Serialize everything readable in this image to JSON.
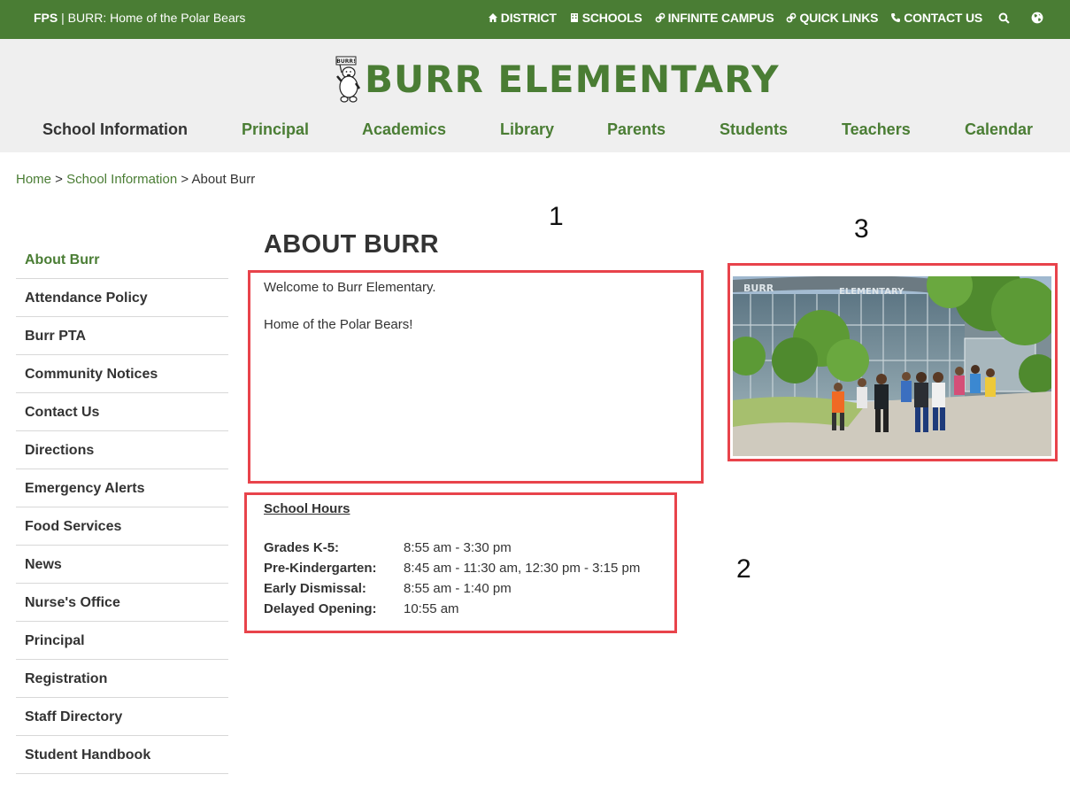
{
  "topbar": {
    "brand_strong": "FPS",
    "brand_rest": " | BURR: Home of the Polar Bears",
    "links": [
      {
        "label": "DISTRICT",
        "icon": "home-icon"
      },
      {
        "label": "SCHOOLS",
        "icon": "building-icon"
      },
      {
        "label": "INFINITE CAMPUS",
        "icon": "link-icon"
      },
      {
        "label": "QUICK LINKS",
        "icon": "link-icon"
      },
      {
        "label": "CONTACT US",
        "icon": "phone-icon"
      }
    ],
    "search_icon": "search-icon",
    "globe_icon": "globe-icon"
  },
  "header": {
    "logo_text": "BURR ELEMENTARY",
    "logo_sign_text": "BURR!",
    "nav": [
      {
        "label": "School Information",
        "active": true
      },
      {
        "label": "Principal"
      },
      {
        "label": "Academics"
      },
      {
        "label": "Library"
      },
      {
        "label": "Parents"
      },
      {
        "label": "Students"
      },
      {
        "label": "Teachers"
      },
      {
        "label": "Calendar"
      }
    ]
  },
  "breadcrumb": {
    "home": "Home",
    "sep1": " > ",
    "section": "School Information",
    "sep2": " > ",
    "current": "About Burr"
  },
  "sidebar": {
    "items": [
      {
        "label": "About Burr",
        "active": true
      },
      {
        "label": "Attendance Policy"
      },
      {
        "label": "Burr PTA"
      },
      {
        "label": "Community Notices"
      },
      {
        "label": "Contact Us"
      },
      {
        "label": "Directions"
      },
      {
        "label": "Emergency Alerts"
      },
      {
        "label": "Food Services"
      },
      {
        "label": "News"
      },
      {
        "label": "Nurse's Office"
      },
      {
        "label": "Principal"
      },
      {
        "label": "Registration"
      },
      {
        "label": "Staff Directory"
      },
      {
        "label": "Student Handbook"
      }
    ]
  },
  "main": {
    "title": "ABOUT BURR",
    "welcome_line1": "Welcome to Burr Elementary.",
    "welcome_line2": "Home of the Polar Bears!",
    "hours": {
      "title": "School Hours",
      "rows": [
        {
          "label": "Grades K-5:",
          "value": "8:55 am - 3:30 pm"
        },
        {
          "label": "Pre-Kindergarten:",
          "value": "8:45 am - 11:30 am, 12:30 pm - 3:15 pm"
        },
        {
          "label": "Early Dismissal:",
          "value": "8:55 am - 1:40 pm"
        },
        {
          "label": "Delayed Opening:",
          "value": "10:55 am"
        }
      ]
    },
    "photo": {
      "sign_left": "BURR",
      "sign_right": "ELEMENTARY"
    }
  },
  "annotations": {
    "n1": "1",
    "n2": "2",
    "n3": "3"
  },
  "colors": {
    "brand_green": "#4a7d34",
    "annotation_red": "#e8434b"
  }
}
